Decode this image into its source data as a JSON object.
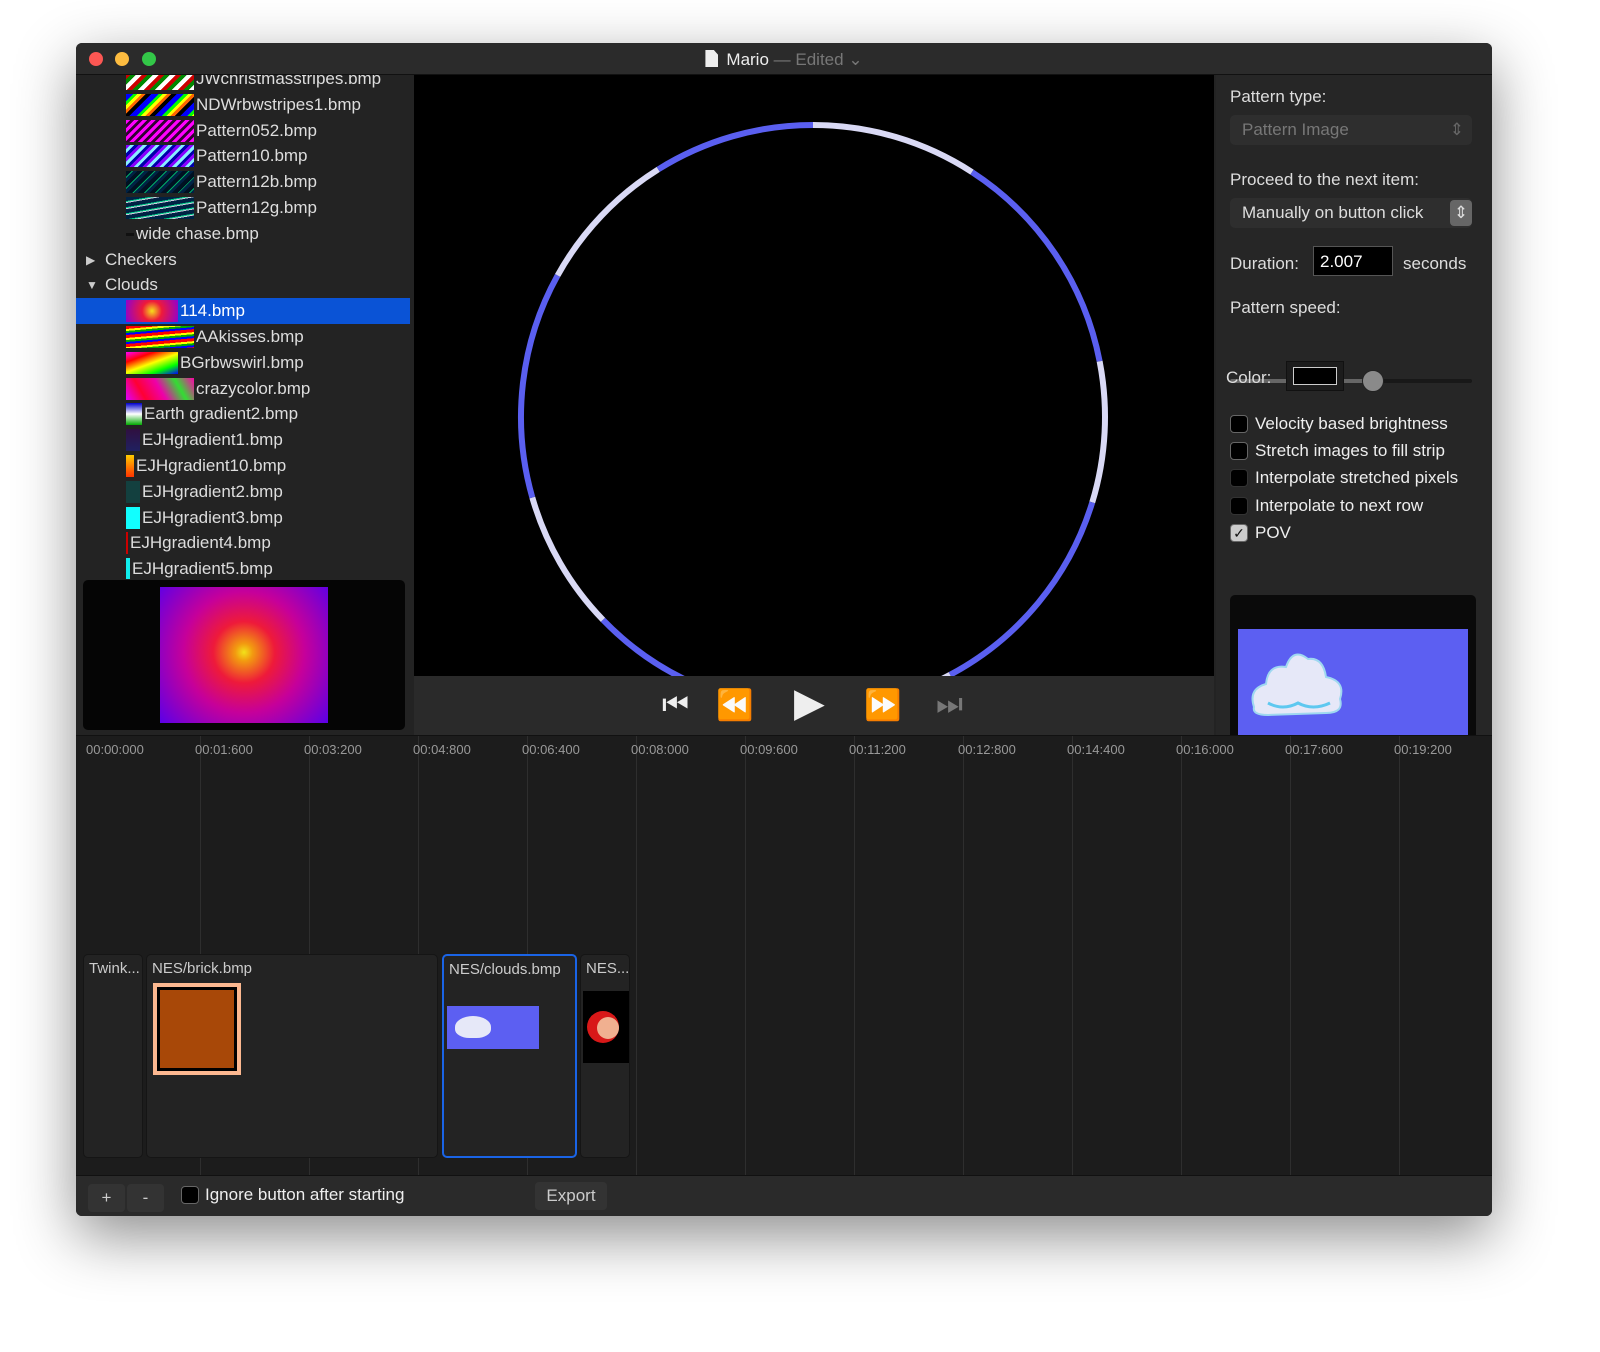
{
  "window": {
    "title": "Mario",
    "status": "— Edited",
    "doc_icon": "document-icon"
  },
  "sidebar": {
    "items": [
      {
        "label": "JWchristmasstripes.bmp",
        "type": "file"
      },
      {
        "label": "NDWrbwstripes1.bmp",
        "type": "file"
      },
      {
        "label": "Pattern052.bmp",
        "type": "file"
      },
      {
        "label": "Pattern10.bmp",
        "type": "file"
      },
      {
        "label": "Pattern12b.bmp",
        "type": "file"
      },
      {
        "label": "Pattern12g.bmp",
        "type": "file"
      },
      {
        "label": "wide chase.bmp",
        "type": "file"
      },
      {
        "label": "Checkers",
        "type": "folder",
        "expanded": false
      },
      {
        "label": "Clouds",
        "type": "folder",
        "expanded": true
      },
      {
        "label": "114.bmp",
        "type": "file",
        "selected": true
      },
      {
        "label": "AAkisses.bmp",
        "type": "file"
      },
      {
        "label": "BGrbwswirl.bmp",
        "type": "file"
      },
      {
        "label": "crazycolor.bmp",
        "type": "file"
      },
      {
        "label": "Earth gradient2.bmp",
        "type": "file"
      },
      {
        "label": "EJHgradient1.bmp",
        "type": "file"
      },
      {
        "label": "EJHgradient10.bmp",
        "type": "file"
      },
      {
        "label": "EJHgradient2.bmp",
        "type": "file"
      },
      {
        "label": "EJHgradient3.bmp",
        "type": "file"
      },
      {
        "label": "EJHgradient4.bmp",
        "type": "file"
      },
      {
        "label": "EJHgradient5.bmp",
        "type": "file"
      }
    ]
  },
  "transport": {
    "icons": [
      "skip-to-start-icon",
      "rewind-icon",
      "play-icon",
      "fast-forward-icon",
      "skip-to-end-icon"
    ]
  },
  "inspector": {
    "pattern_type_label": "Pattern type:",
    "pattern_type_value": "Pattern Image",
    "proceed_label": "Proceed to the next item:",
    "proceed_value": "Manually on button click",
    "duration_label": "Duration:",
    "duration_value": "2.007",
    "duration_unit": "seconds",
    "speed_label": "Pattern speed:",
    "speed_value_percent": 59,
    "color_label": "Color:",
    "color_value": "#000000",
    "checkboxes": [
      {
        "label": "Velocity based brightness",
        "checked": false,
        "enabled": true
      },
      {
        "label": "Stretch images to fill strip",
        "checked": false,
        "enabled": true
      },
      {
        "label": "Interpolate stretched pixels",
        "checked": false,
        "enabled": false
      },
      {
        "label": "Interpolate to next row",
        "checked": false,
        "enabled": false
      },
      {
        "label": "POV",
        "checked": true,
        "enabled": true
      }
    ]
  },
  "timeline": {
    "ticks": [
      "00:00:000",
      "00:01:600",
      "00:03:200",
      "00:04:800",
      "00:06:400",
      "00:08:000",
      "00:09:600",
      "00:11:200",
      "00:12:800",
      "00:14:400",
      "00:16:000",
      "00:17:600",
      "00:19:200"
    ],
    "clips": [
      {
        "label": "Twink..."
      },
      {
        "label": "NES/brick.bmp"
      },
      {
        "label": "NES/clouds.bmp",
        "selected": true
      },
      {
        "label": "NES..."
      }
    ]
  },
  "bottom": {
    "add": "+",
    "remove": "-",
    "ignore_label": "Ignore button after starting",
    "ignore_checked": false,
    "export": "Export"
  },
  "colors": {
    "accent": "#0a53d6",
    "pov_blue": "#5a5ff0",
    "pov_light": "#d9d9f5",
    "cloud_bg": "#5c5ff2"
  }
}
